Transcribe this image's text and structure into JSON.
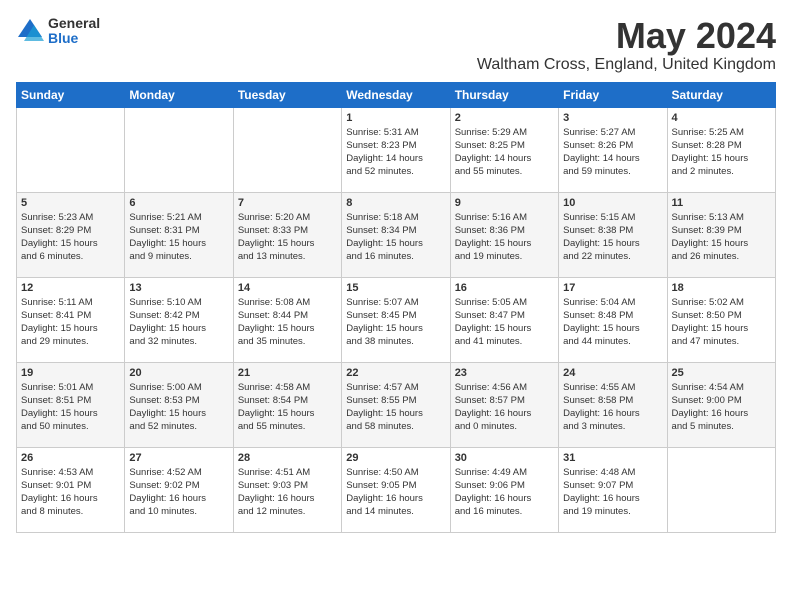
{
  "logo": {
    "general": "General",
    "blue": "Blue"
  },
  "title": "May 2024",
  "location": "Waltham Cross, England, United Kingdom",
  "days_header": [
    "Sunday",
    "Monday",
    "Tuesday",
    "Wednesday",
    "Thursday",
    "Friday",
    "Saturday"
  ],
  "weeks": [
    [
      {
        "day": "",
        "info": ""
      },
      {
        "day": "",
        "info": ""
      },
      {
        "day": "",
        "info": ""
      },
      {
        "day": "1",
        "info": "Sunrise: 5:31 AM\nSunset: 8:23 PM\nDaylight: 14 hours\nand 52 minutes."
      },
      {
        "day": "2",
        "info": "Sunrise: 5:29 AM\nSunset: 8:25 PM\nDaylight: 14 hours\nand 55 minutes."
      },
      {
        "day": "3",
        "info": "Sunrise: 5:27 AM\nSunset: 8:26 PM\nDaylight: 14 hours\nand 59 minutes."
      },
      {
        "day": "4",
        "info": "Sunrise: 5:25 AM\nSunset: 8:28 PM\nDaylight: 15 hours\nand 2 minutes."
      }
    ],
    [
      {
        "day": "5",
        "info": "Sunrise: 5:23 AM\nSunset: 8:29 PM\nDaylight: 15 hours\nand 6 minutes."
      },
      {
        "day": "6",
        "info": "Sunrise: 5:21 AM\nSunset: 8:31 PM\nDaylight: 15 hours\nand 9 minutes."
      },
      {
        "day": "7",
        "info": "Sunrise: 5:20 AM\nSunset: 8:33 PM\nDaylight: 15 hours\nand 13 minutes."
      },
      {
        "day": "8",
        "info": "Sunrise: 5:18 AM\nSunset: 8:34 PM\nDaylight: 15 hours\nand 16 minutes."
      },
      {
        "day": "9",
        "info": "Sunrise: 5:16 AM\nSunset: 8:36 PM\nDaylight: 15 hours\nand 19 minutes."
      },
      {
        "day": "10",
        "info": "Sunrise: 5:15 AM\nSunset: 8:38 PM\nDaylight: 15 hours\nand 22 minutes."
      },
      {
        "day": "11",
        "info": "Sunrise: 5:13 AM\nSunset: 8:39 PM\nDaylight: 15 hours\nand 26 minutes."
      }
    ],
    [
      {
        "day": "12",
        "info": "Sunrise: 5:11 AM\nSunset: 8:41 PM\nDaylight: 15 hours\nand 29 minutes."
      },
      {
        "day": "13",
        "info": "Sunrise: 5:10 AM\nSunset: 8:42 PM\nDaylight: 15 hours\nand 32 minutes."
      },
      {
        "day": "14",
        "info": "Sunrise: 5:08 AM\nSunset: 8:44 PM\nDaylight: 15 hours\nand 35 minutes."
      },
      {
        "day": "15",
        "info": "Sunrise: 5:07 AM\nSunset: 8:45 PM\nDaylight: 15 hours\nand 38 minutes."
      },
      {
        "day": "16",
        "info": "Sunrise: 5:05 AM\nSunset: 8:47 PM\nDaylight: 15 hours\nand 41 minutes."
      },
      {
        "day": "17",
        "info": "Sunrise: 5:04 AM\nSunset: 8:48 PM\nDaylight: 15 hours\nand 44 minutes."
      },
      {
        "day": "18",
        "info": "Sunrise: 5:02 AM\nSunset: 8:50 PM\nDaylight: 15 hours\nand 47 minutes."
      }
    ],
    [
      {
        "day": "19",
        "info": "Sunrise: 5:01 AM\nSunset: 8:51 PM\nDaylight: 15 hours\nand 50 minutes."
      },
      {
        "day": "20",
        "info": "Sunrise: 5:00 AM\nSunset: 8:53 PM\nDaylight: 15 hours\nand 52 minutes."
      },
      {
        "day": "21",
        "info": "Sunrise: 4:58 AM\nSunset: 8:54 PM\nDaylight: 15 hours\nand 55 minutes."
      },
      {
        "day": "22",
        "info": "Sunrise: 4:57 AM\nSunset: 8:55 PM\nDaylight: 15 hours\nand 58 minutes."
      },
      {
        "day": "23",
        "info": "Sunrise: 4:56 AM\nSunset: 8:57 PM\nDaylight: 16 hours\nand 0 minutes."
      },
      {
        "day": "24",
        "info": "Sunrise: 4:55 AM\nSunset: 8:58 PM\nDaylight: 16 hours\nand 3 minutes."
      },
      {
        "day": "25",
        "info": "Sunrise: 4:54 AM\nSunset: 9:00 PM\nDaylight: 16 hours\nand 5 minutes."
      }
    ],
    [
      {
        "day": "26",
        "info": "Sunrise: 4:53 AM\nSunset: 9:01 PM\nDaylight: 16 hours\nand 8 minutes."
      },
      {
        "day": "27",
        "info": "Sunrise: 4:52 AM\nSunset: 9:02 PM\nDaylight: 16 hours\nand 10 minutes."
      },
      {
        "day": "28",
        "info": "Sunrise: 4:51 AM\nSunset: 9:03 PM\nDaylight: 16 hours\nand 12 minutes."
      },
      {
        "day": "29",
        "info": "Sunrise: 4:50 AM\nSunset: 9:05 PM\nDaylight: 16 hours\nand 14 minutes."
      },
      {
        "day": "30",
        "info": "Sunrise: 4:49 AM\nSunset: 9:06 PM\nDaylight: 16 hours\nand 16 minutes."
      },
      {
        "day": "31",
        "info": "Sunrise: 4:48 AM\nSunset: 9:07 PM\nDaylight: 16 hours\nand 19 minutes."
      },
      {
        "day": "",
        "info": ""
      }
    ]
  ]
}
